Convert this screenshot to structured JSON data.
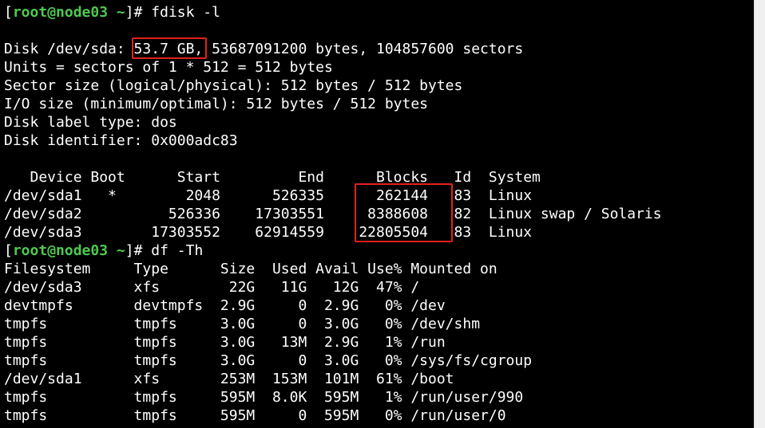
{
  "terminal": {
    "lines": [
      {
        "type": "prompt",
        "user": "root@node03",
        "path": "~",
        "symbol": "]#",
        "command": " fdisk -l"
      },
      {
        "type": "text",
        "text": ""
      },
      {
        "type": "text",
        "text": "Disk /dev/sda: 53.7 GB, 53687091200 bytes, 104857600 sectors"
      },
      {
        "type": "text",
        "text": "Units = sectors of 1 * 512 = 512 bytes"
      },
      {
        "type": "text",
        "text": "Sector size (logical/physical): 512 bytes / 512 bytes"
      },
      {
        "type": "text",
        "text": "I/O size (minimum/optimal): 512 bytes / 512 bytes"
      },
      {
        "type": "text",
        "text": "Disk label type: dos"
      },
      {
        "type": "text",
        "text": "Disk identifier: 0x000adc83"
      },
      {
        "type": "text",
        "text": ""
      },
      {
        "type": "text",
        "text": "   Device Boot      Start         End      Blocks   Id  System"
      },
      {
        "type": "text",
        "text": "/dev/sda1   *        2048      526335      262144   83  Linux"
      },
      {
        "type": "text",
        "text": "/dev/sda2          526336    17303551     8388608   82  Linux swap / Solaris"
      },
      {
        "type": "text",
        "text": "/dev/sda3        17303552    62914559    22805504   83  Linux"
      },
      {
        "type": "prompt",
        "user": "root@node03",
        "path": "~",
        "symbol": "]#",
        "command": " df -Th"
      },
      {
        "type": "text",
        "text": "Filesystem     Type      Size  Used Avail Use% Mounted on"
      },
      {
        "type": "text",
        "text": "/dev/sda3      xfs        22G   11G   12G  47% /"
      },
      {
        "type": "text",
        "text": "devtmpfs       devtmpfs  2.9G     0  2.9G   0% /dev"
      },
      {
        "type": "text",
        "text": "tmpfs          tmpfs     3.0G     0  3.0G   0% /dev/shm"
      },
      {
        "type": "text",
        "text": "tmpfs          tmpfs     3.0G   13M  2.9G   1% /run"
      },
      {
        "type": "text",
        "text": "tmpfs          tmpfs     3.0G     0  3.0G   0% /sys/fs/cgroup"
      },
      {
        "type": "text",
        "text": "/dev/sda1      xfs       253M  153M  101M  61% /boot"
      },
      {
        "type": "text",
        "text": "tmpfs          tmpfs     595M  8.0K  595M   1% /run/user/990"
      },
      {
        "type": "text",
        "text": "tmpfs          tmpfs     595M     0  595M   0% /run/user/0"
      }
    ]
  },
  "colors": {
    "background": "#000000",
    "text": "#ffffff",
    "prompt_user": "#4ec94e",
    "highlight_box": "#e0221b"
  }
}
